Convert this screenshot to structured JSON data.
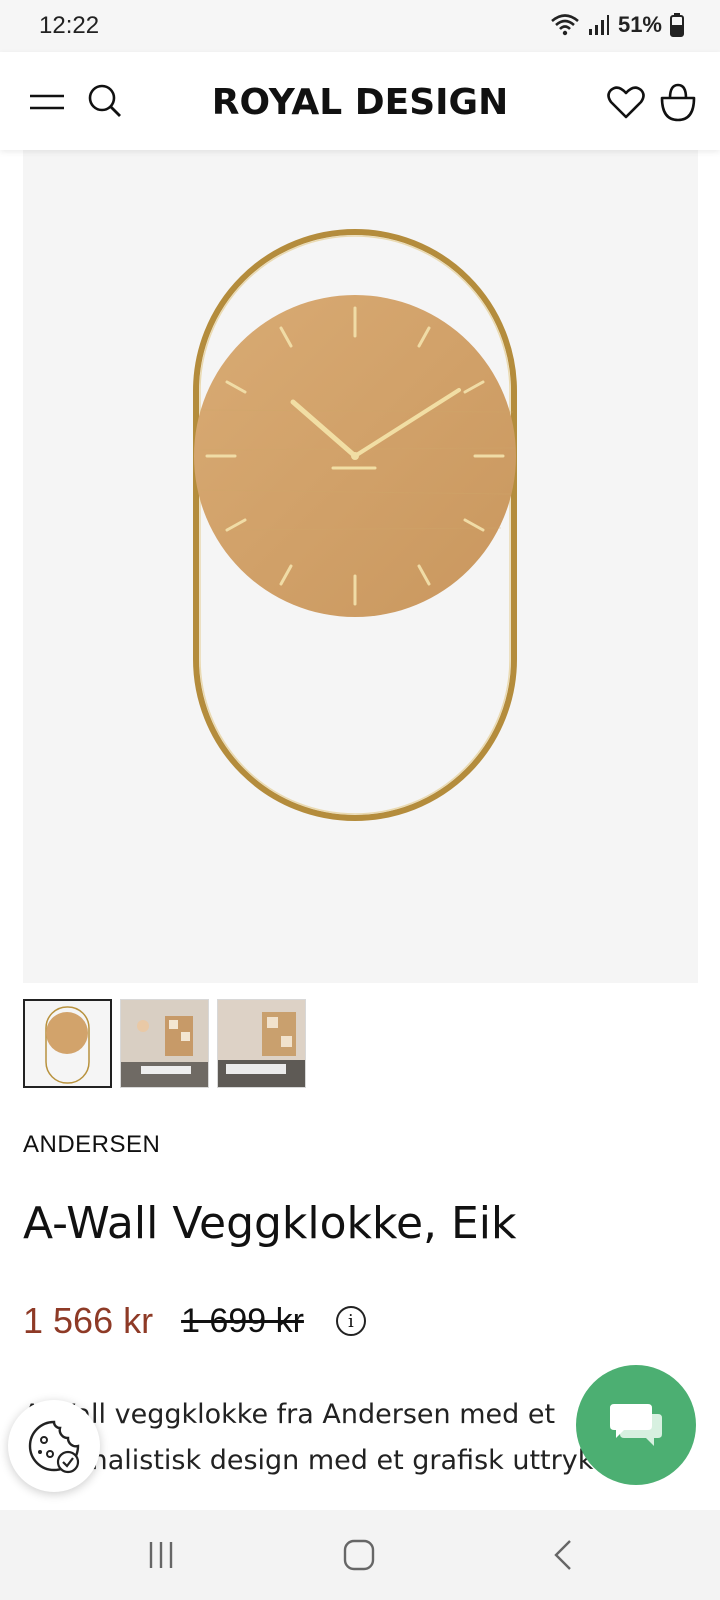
{
  "status_bar": {
    "time": "12:22",
    "battery": "51%"
  },
  "header": {
    "brand": "ROYAL DESIGN"
  },
  "product": {
    "brand": "ANDERSEN",
    "title": "A-Wall Veggklokke, Eik",
    "price_current": "1 566 kr",
    "price_old": "1 699 kr",
    "info_symbol": "i",
    "description": "A-Wall veggklokke fra Andersen med et minimalistisk design med et grafisk uttrykk."
  },
  "thumbnails": {
    "count": 3,
    "active_index": 0
  },
  "colors": {
    "price_sale": "#8e3a26",
    "chat_button": "#4caf72",
    "clock_wood": "#d2a36b",
    "clock_brass": "#b8923e"
  }
}
